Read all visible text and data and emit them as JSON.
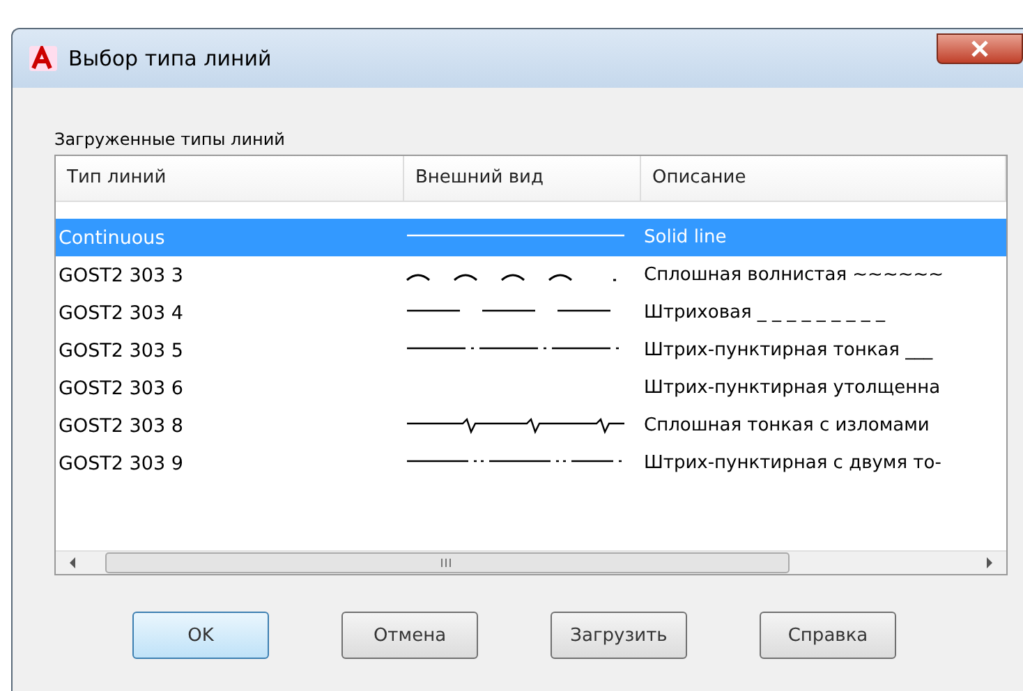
{
  "window": {
    "title": "Выбор типа линий"
  },
  "list_label": "Загруженные типы линий",
  "table": {
    "columns": [
      "Тип линий",
      "Внешний вид",
      "Описание"
    ],
    "rows": [
      {
        "name": "Continuous",
        "kind": "solid",
        "description": "Solid line",
        "selected": true
      },
      {
        "name": "GOST2 303 3",
        "kind": "wavy",
        "description": "Сплошная волнистая ~~~~~~",
        "selected": false
      },
      {
        "name": "GOST2 303 4",
        "kind": "dashed",
        "description": "Штриховая _ _ _ _ _ _ _ _ _",
        "selected": false
      },
      {
        "name": "GOST2 303 5",
        "kind": "dashdot",
        "description": "Штрих-пунктирная тонкая ___",
        "selected": false
      },
      {
        "name": "GOST2 303 6",
        "kind": "blank",
        "description": "Штрих-пунктирная утолщенна",
        "selected": false
      },
      {
        "name": "GOST2 303 8",
        "kind": "zigzag",
        "description": "Сплошная тонкая с изломами",
        "selected": false
      },
      {
        "name": "GOST2 303 9",
        "kind": "dashdotdot",
        "description": "Штрих-пунктирная с двумя то-",
        "selected": false
      }
    ]
  },
  "buttons": [
    {
      "label": "OK",
      "default": true
    },
    {
      "label": "Отмена",
      "default": false
    },
    {
      "label": "Загрузить",
      "default": false
    },
    {
      "label": "Справка",
      "default": false
    }
  ]
}
